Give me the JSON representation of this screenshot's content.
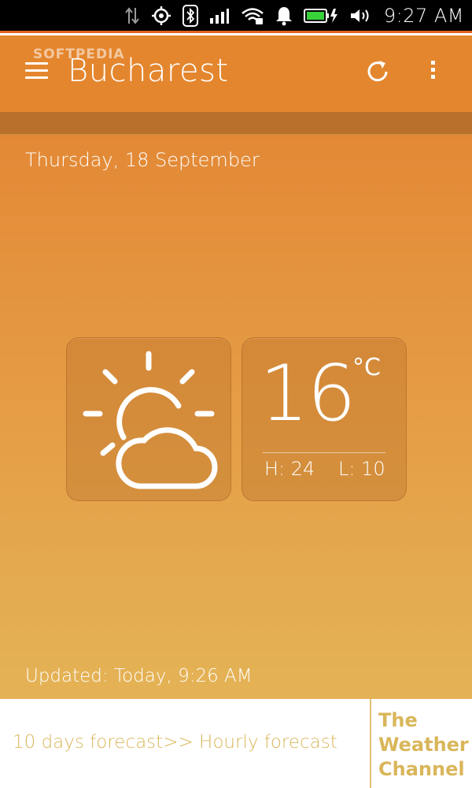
{
  "status_bar": {
    "time": "9:27 AM",
    "icons": [
      "data-transfer-icon",
      "location-icon",
      "bluetooth-icon",
      "signal-icon",
      "wifi-icon",
      "notification-bell-icon",
      "battery-charging-icon",
      "volume-icon"
    ]
  },
  "header": {
    "watermark": "SOFTPEDIA",
    "city": "Bucharest",
    "icons": [
      "menu-icon",
      "refresh-icon",
      "more-options-icon"
    ]
  },
  "weather": {
    "date": "Thursday, 18 September",
    "condition_icon": "partly-cloudy-icon",
    "temperature": "16",
    "unit": "°C",
    "high": "H: 24",
    "low": "L: 10",
    "updated": "Updated: Today, 9:26 AM"
  },
  "footer": {
    "ten_day_link": "10 days forecast>>",
    "hourly_link": "Hourly forecast",
    "brand_lines": [
      "The",
      "Weather",
      "Channel"
    ]
  },
  "colors": {
    "header": "#e4862e",
    "band": "#b8702c",
    "gradient_top": "#e38936",
    "gradient_bottom": "#e4b356",
    "footer_text": "#d9b65a",
    "status_accent": "#e2621f"
  }
}
